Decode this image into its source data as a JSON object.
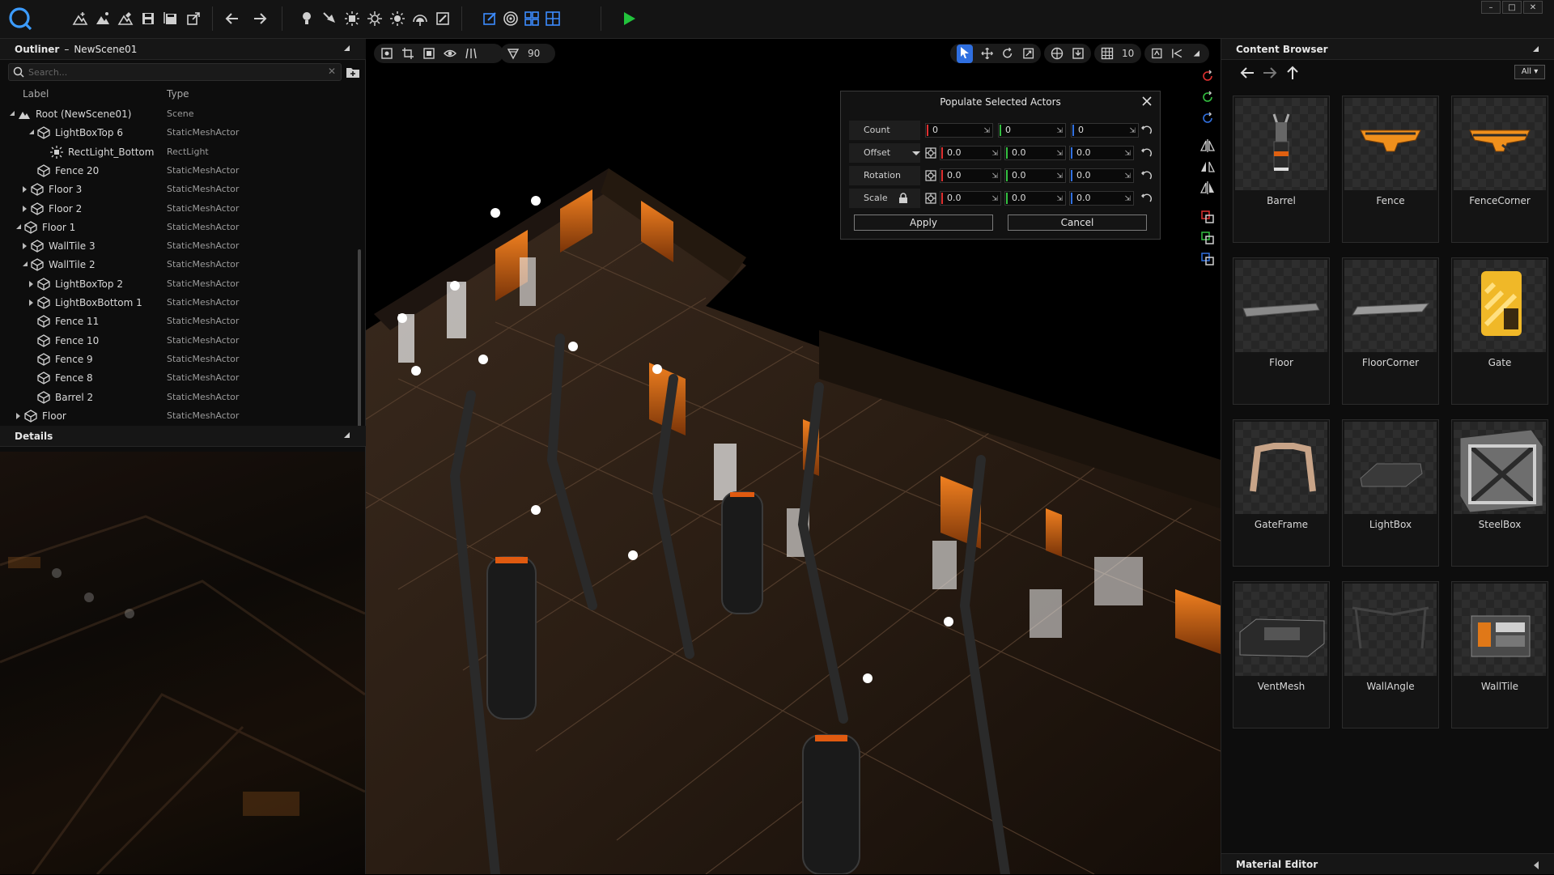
{
  "window": {
    "minimize_label": "–",
    "maximize_label": "□",
    "close_label": "✕"
  },
  "outliner": {
    "title": "Outliner",
    "separator": "–",
    "scene_name": "NewScene01",
    "search_placeholder": "Search...",
    "col_label": "Label",
    "col_type": "Type",
    "rows": [
      {
        "label": "Root (NewScene01)",
        "type": "Scene"
      },
      {
        "label": "LightBoxTop 6",
        "type": "StaticMeshActor"
      },
      {
        "label": "RectLight_Bottom",
        "type": "RectLight"
      },
      {
        "label": "Fence 20",
        "type": "StaticMeshActor"
      },
      {
        "label": "Floor 3",
        "type": "StaticMeshActor"
      },
      {
        "label": "Floor 2",
        "type": "StaticMeshActor"
      },
      {
        "label": "Floor 1",
        "type": "StaticMeshActor"
      },
      {
        "label": "WallTile 3",
        "type": "StaticMeshActor"
      },
      {
        "label": "WallTile 2",
        "type": "StaticMeshActor"
      },
      {
        "label": "LightBoxTop 2",
        "type": "StaticMeshActor"
      },
      {
        "label": "LightBoxBottom 1",
        "type": "StaticMeshActor"
      },
      {
        "label": "Fence 11",
        "type": "StaticMeshActor"
      },
      {
        "label": "Fence 10",
        "type": "StaticMeshActor"
      },
      {
        "label": "Fence 9",
        "type": "StaticMeshActor"
      },
      {
        "label": "Fence 8",
        "type": "StaticMeshActor"
      },
      {
        "label": "Barrel 2",
        "type": "StaticMeshActor"
      },
      {
        "label": "Floor",
        "type": "StaticMeshActor"
      }
    ]
  },
  "details": {
    "title": "Details"
  },
  "viewport": {
    "fov_value": "90",
    "grid_value": "10"
  },
  "populate_dialog": {
    "title": "Populate Selected Actors",
    "count_label": "Count",
    "offset_label": "Offset",
    "rotation_label": "Rotation",
    "scale_label": "Scale",
    "count": [
      "0",
      "0",
      "0"
    ],
    "offset": [
      "0.0",
      "0.0",
      "0.0"
    ],
    "rotation": [
      "0.0",
      "0.0",
      "0.0"
    ],
    "scale": [
      "0.0",
      "0.0",
      "0.0"
    ],
    "apply_label": "Apply",
    "cancel_label": "Cancel"
  },
  "content_browser": {
    "title": "Content Browser",
    "filter_label": "All",
    "assets": [
      "Barrel",
      "Fence",
      "FenceCorner",
      "Floor",
      "FloorCorner",
      "Gate",
      "GateFrame",
      "LightBox",
      "SteelBox",
      "VentMesh",
      "WallAngle",
      "WallTile"
    ]
  },
  "material_editor": {
    "title": "Material Editor"
  },
  "colors": {
    "accent_blue": "#3c8cff",
    "play_green": "#22c33c",
    "scene_orange": "#e8701c"
  }
}
